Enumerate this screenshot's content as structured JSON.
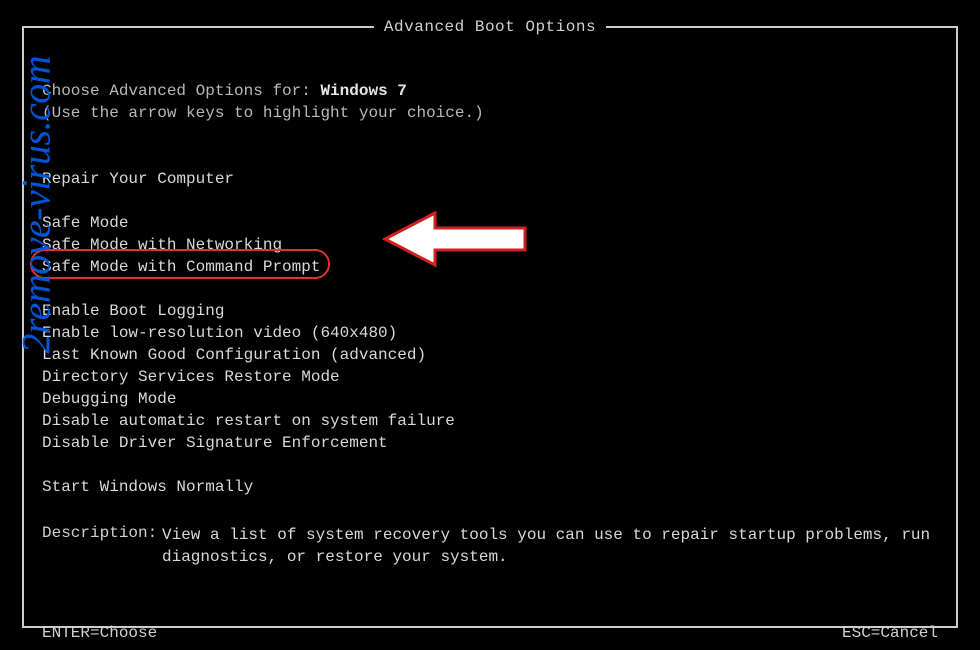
{
  "title": "Advanced Boot Options",
  "choose_label": "Choose Advanced Options for: ",
  "os_name": "Windows 7",
  "hint": "(Use the arrow keys to highlight your choice.)",
  "repair": "Repair Your Computer",
  "menu": {
    "group1": [
      "Safe Mode",
      "Safe Mode with Networking",
      "Safe Mode with Command Prompt"
    ],
    "group2": [
      "Enable Boot Logging",
      "Enable low-resolution video (640x480)",
      "Last Known Good Configuration (advanced)",
      "Directory Services Restore Mode",
      "Debugging Mode",
      "Disable automatic restart on system failure",
      "Disable Driver Signature Enforcement"
    ],
    "group3": [
      "Start Windows Normally"
    ]
  },
  "description": {
    "label": "Description:",
    "text": "View a list of system recovery tools you can use to repair startup problems, run diagnostics, or restore your system."
  },
  "footer": {
    "left": "ENTER=Choose",
    "right": "ESC=Cancel"
  },
  "watermark": "2remove-virus.com"
}
